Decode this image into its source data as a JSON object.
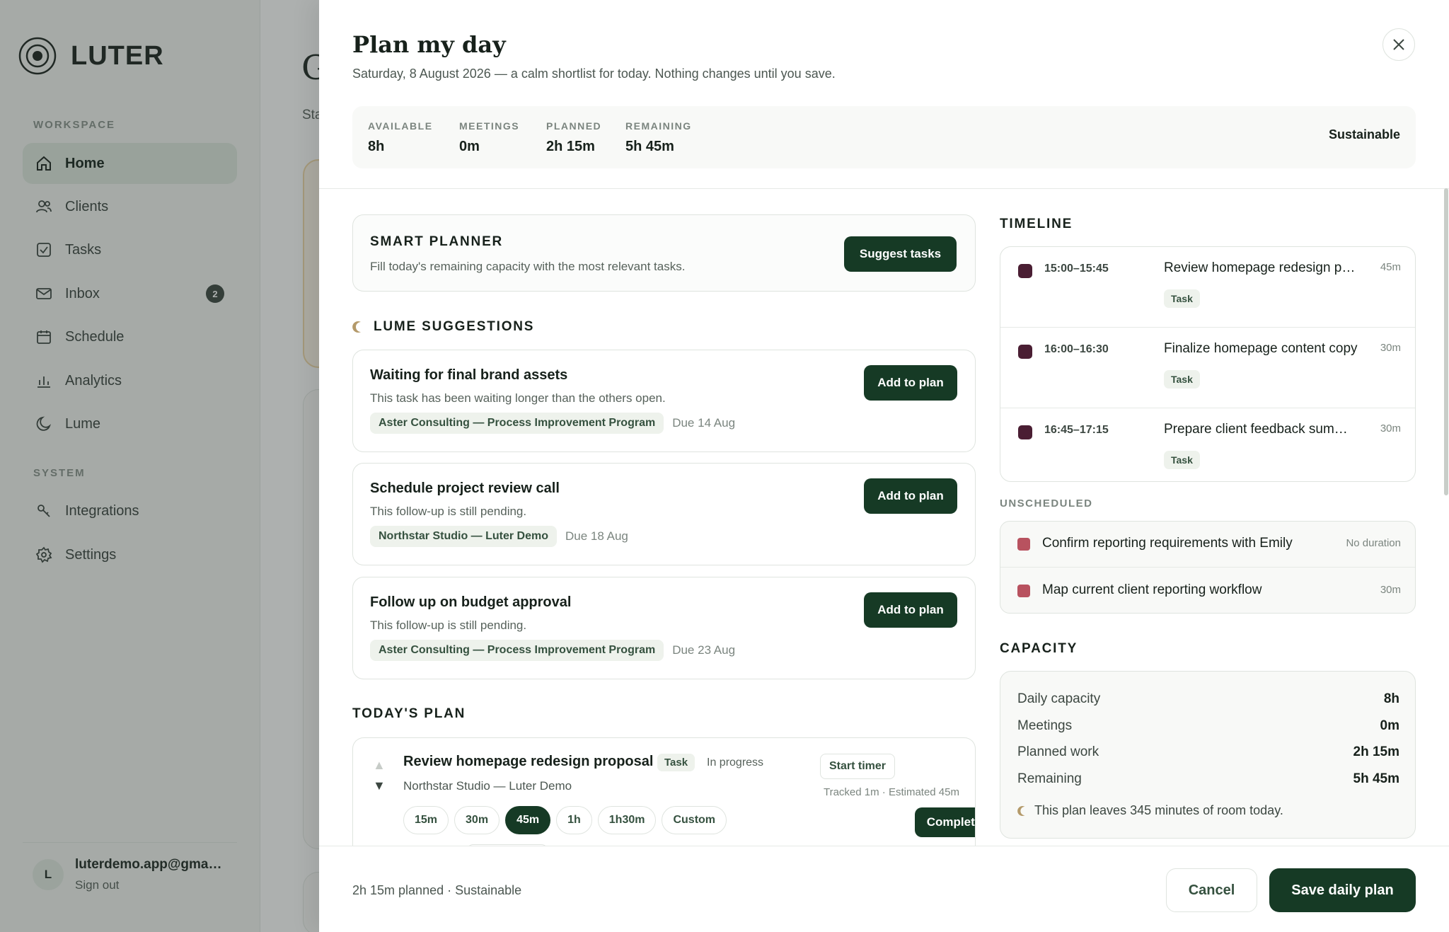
{
  "app": {
    "brand": "LUTER",
    "workspace_label": "WORKSPACE",
    "system_label": "SYSTEM",
    "nav": [
      {
        "label": "Home",
        "icon": "home-icon",
        "active": true
      },
      {
        "label": "Clients",
        "icon": "users-icon"
      },
      {
        "label": "Tasks",
        "icon": "checkbox-icon"
      },
      {
        "label": "Inbox",
        "icon": "mail-icon",
        "badge": "2"
      },
      {
        "label": "Schedule",
        "icon": "calendar-icon"
      },
      {
        "label": "Analytics",
        "icon": "bar-chart-icon"
      },
      {
        "label": "Lume",
        "icon": "moon-icon"
      }
    ],
    "system_nav": [
      {
        "label": "Integrations",
        "icon": "key-icon"
      },
      {
        "label": "Settings",
        "icon": "gear-icon"
      }
    ],
    "user": {
      "initial": "L",
      "email": "luterdemo.app@gma…",
      "signout": "Sign out"
    },
    "bg_title": "G",
    "bg_sub": "Sta"
  },
  "drawer": {
    "title": "Plan my day",
    "subtitle": "Saturday, 8 August 2026 — a calm shortlist for today. Nothing changes until you save.",
    "stats": [
      {
        "label": "AVAILABLE",
        "value": "8h"
      },
      {
        "label": "MEETINGS",
        "value": "0m"
      },
      {
        "label": "PLANNED",
        "value": "2h 15m"
      },
      {
        "label": "REMAINING",
        "value": "5h 45m"
      }
    ],
    "status": "Sustainable",
    "smart_planner": {
      "title": "SMART PLANNER",
      "desc": "Fill today's remaining capacity with the most relevant tasks.",
      "button": "Suggest tasks"
    },
    "suggestions_heading": "LUME SUGGESTIONS",
    "suggestions": [
      {
        "title": "Waiting for final brand assets",
        "desc": "This task has been waiting longer than the others open.",
        "client": "Aster Consulting — Process Improvement Program",
        "due": "Due 14 Aug",
        "button": "Add to plan"
      },
      {
        "title": "Schedule project review call",
        "desc": "This follow-up is still pending.",
        "client": "Northstar Studio — Luter Demo",
        "due": "Due 18 Aug",
        "button": "Add to plan"
      },
      {
        "title": "Follow up on budget approval",
        "desc": "This follow-up is still pending.",
        "client": "Aster Consulting — Process Improvement Program",
        "due": "Due 23 Aug",
        "button": "Add to plan"
      }
    ],
    "todays_plan_heading": "TODAY'S PLAN",
    "plan_item": {
      "title": "Review homepage redesign proposal",
      "tag": "Task",
      "status": "In progress",
      "client": "Northstar Studio — Luter Demo",
      "timer_button": "Start timer",
      "tracked": "Tracked 1m · Estimated 45m",
      "durations": [
        "15m",
        "30m",
        "45m",
        "1h",
        "1h30m",
        "Custom"
      ],
      "selected_duration": "45m",
      "complete_button": "Complete"
    },
    "timeline_heading": "TIMELINE",
    "timeline": [
      {
        "time": "15:00–15:45",
        "title": "Review homepage redesign proposal",
        "duration": "45m",
        "tag": "Task"
      },
      {
        "time": "16:00–16:30",
        "title": "Finalize homepage content copy",
        "duration": "30m",
        "tag": "Task"
      },
      {
        "time": "16:45–17:15",
        "title": "Prepare client feedback summary",
        "duration": "30m",
        "tag": "Task"
      }
    ],
    "unscheduled_heading": "UNSCHEDULED",
    "unscheduled": [
      {
        "title": "Confirm reporting requirements with Emily",
        "duration": "No duration"
      },
      {
        "title": "Map current client reporting workflow",
        "duration": "30m"
      }
    ],
    "capacity_heading": "CAPACITY",
    "capacity": [
      {
        "label": "Daily capacity",
        "value": "8h"
      },
      {
        "label": "Meetings",
        "value": "0m"
      },
      {
        "label": "Planned work",
        "value": "2h 15m"
      },
      {
        "label": "Remaining",
        "value": "5h 45m"
      }
    ],
    "capacity_note": "This plan leaves 345 minutes of room today.",
    "footer": {
      "summary": "2h 15m planned · Sustainable",
      "cancel": "Cancel",
      "save": "Save daily plan"
    }
  },
  "colors": {
    "accent": "#163a25",
    "timeline_dot": "#4a1e33",
    "unscheduled_dot": "#b8525f"
  }
}
